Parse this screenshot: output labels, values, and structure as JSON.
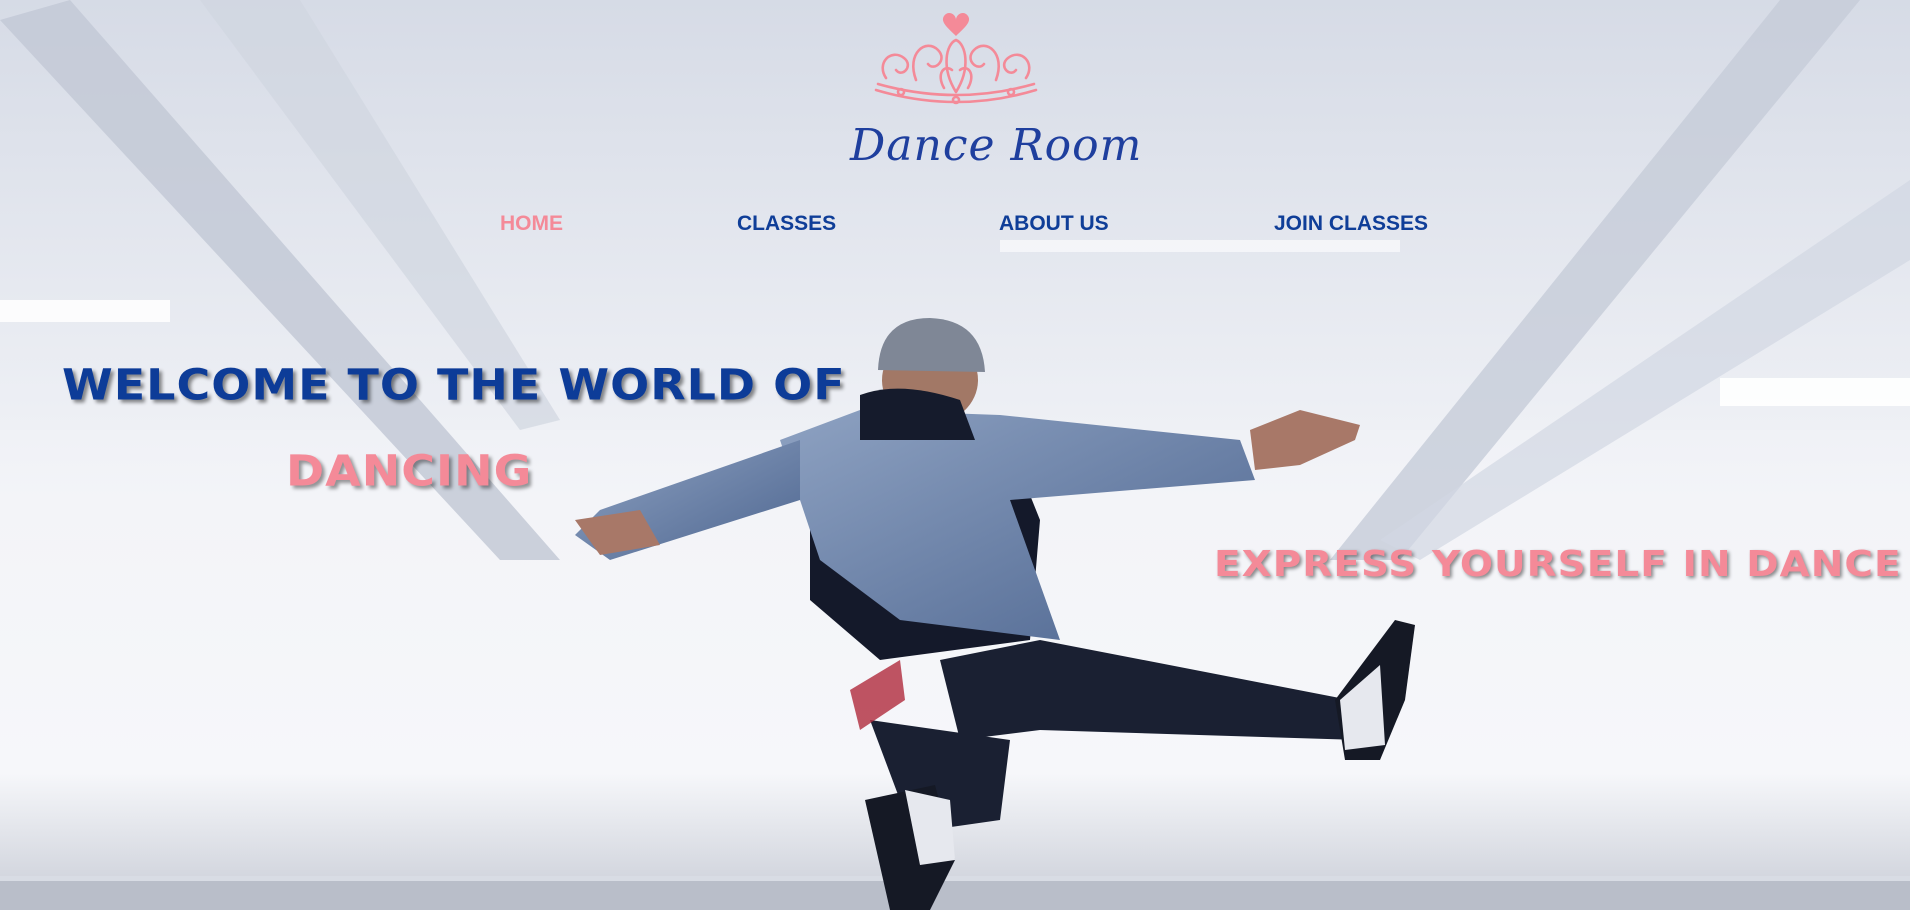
{
  "brand": {
    "name": "Dance Room",
    "accent_color": "#f48a98",
    "primary_color": "#0f3e98",
    "logo_icon": "tiara-heart-icon"
  },
  "nav": {
    "items": [
      {
        "label": "HOME",
        "active": true
      },
      {
        "label": "CLASSES",
        "active": false
      },
      {
        "label": "ABOUT US",
        "active": false
      },
      {
        "label": "JOIN CLASSES",
        "active": false
      }
    ]
  },
  "hero": {
    "headline_line1": "WELCOME TO THE WORLD OF",
    "headline_line2": "DANCING",
    "tagline": "EXPRESS YOURSELF IN DANCE",
    "background_image": "dancer-jumping-photo"
  }
}
